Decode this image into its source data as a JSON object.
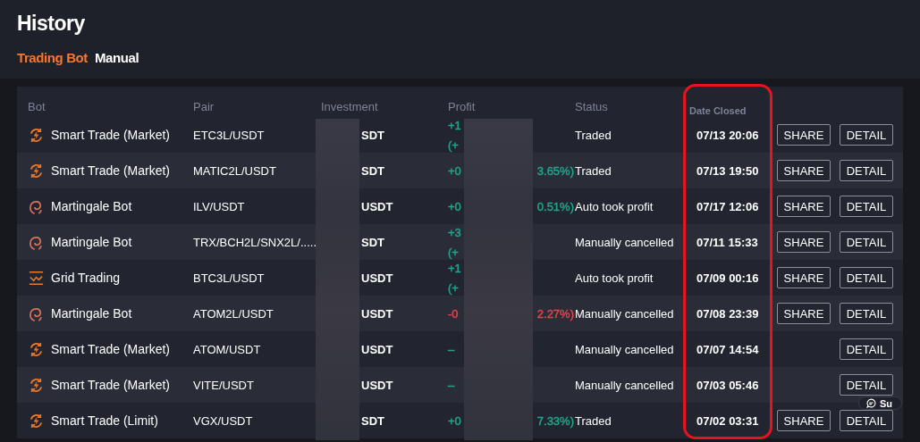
{
  "page": {
    "title": "History"
  },
  "tabs": [
    {
      "label": "Trading Bot",
      "selected": true
    },
    {
      "label": "Manual",
      "selected": false
    }
  ],
  "table": {
    "columns": [
      "Bot",
      "Pair",
      "Investment",
      "Profit",
      "Status",
      "Date Closed"
    ],
    "date_column_outlined": true,
    "rows": [
      {
        "bot": {
          "kind": "smart",
          "name": "Smart Trade (Market)"
        },
        "pair": "ETC3L/USDT",
        "investment": "SDT",
        "profit": {
          "color": "#21a78c",
          "lines": [
            "+1",
            "(+"
          ]
        },
        "status": "Traded",
        "date_closed": "07/13 20:06",
        "actions": [
          "SHARE",
          "DETAIL"
        ]
      },
      {
        "bot": {
          "kind": "smart",
          "name": "Smart Trade (Market)"
        },
        "pair": "MATIC2L/USDT",
        "investment": "SDT",
        "profit": {
          "color": "#21a78c",
          "lines": [
            "+0"
          ],
          "end": "3.65%)"
        },
        "status": "Traded",
        "date_closed": "07/13 19:50",
        "actions": [
          "SHARE",
          "DETAIL"
        ]
      },
      {
        "bot": {
          "kind": "martingale",
          "name": "Martingale Bot"
        },
        "pair": "ILV/USDT",
        "investment": "USDT",
        "profit": {
          "color": "#21a78c",
          "lines": [
            "+0"
          ],
          "end": "0.51%)"
        },
        "status": "Auto took profit",
        "date_closed": "07/17 12:06",
        "actions": [
          "SHARE",
          "DETAIL"
        ]
      },
      {
        "bot": {
          "kind": "martingale",
          "name": "Martingale Bot"
        },
        "pair": "TRX/BCH2L/SNX2L/.....",
        "investment": "SDT",
        "profit": {
          "color": "#21a78c",
          "lines": [
            "+3",
            "(+"
          ]
        },
        "status": "Manually cancelled",
        "date_closed": "07/11 15:33",
        "actions": [
          "SHARE",
          "DETAIL"
        ]
      },
      {
        "bot": {
          "kind": "grid",
          "name": "Grid Trading"
        },
        "pair": "BTC3L/USDT",
        "investment": "USDT",
        "profit": {
          "color": "#21a78c",
          "lines": [
            "+1",
            "(+"
          ]
        },
        "status": "Auto took profit",
        "date_closed": "07/09 00:16",
        "actions": [
          "SHARE",
          "DETAIL"
        ]
      },
      {
        "bot": {
          "kind": "martingale",
          "name": "Martingale Bot"
        },
        "pair": "ATOM2L/USDT",
        "investment": "USDT",
        "profit": {
          "color": "#e5454d",
          "lines": [
            "-0"
          ],
          "end": "2.27%)"
        },
        "status": "Manually cancelled",
        "date_closed": "07/08 23:39",
        "actions": [
          "SHARE",
          "DETAIL"
        ]
      },
      {
        "bot": {
          "kind": "smart",
          "name": "Smart Trade (Market)"
        },
        "pair": "ATOM/USDT",
        "investment": "USDT",
        "profit": {
          "color": "#21a78c",
          "lines": [
            "–"
          ]
        },
        "status": "Manually cancelled",
        "date_closed": "07/07 14:54",
        "actions": [
          "DETAIL"
        ]
      },
      {
        "bot": {
          "kind": "smart",
          "name": "Smart Trade (Market)"
        },
        "pair": "VITE/USDT",
        "investment": "USDT",
        "profit": {
          "color": "#21a78c",
          "lines": [
            "–"
          ]
        },
        "status": "Manually cancelled",
        "date_closed": "07/03 05:46",
        "actions": [
          "DETAIL"
        ]
      },
      {
        "bot": {
          "kind": "smart",
          "name": "Smart Trade (Limit)"
        },
        "pair": "VGX/USDT",
        "investment": "SDT",
        "profit": {
          "color": "#21a78c",
          "lines": [
            "+0"
          ],
          "end": "7.33%)"
        },
        "status": "Traded",
        "date_closed": "07/02 03:31",
        "actions": [
          "SHARE",
          "DETAIL"
        ]
      }
    ]
  },
  "support_button": {
    "label": "Su"
  }
}
